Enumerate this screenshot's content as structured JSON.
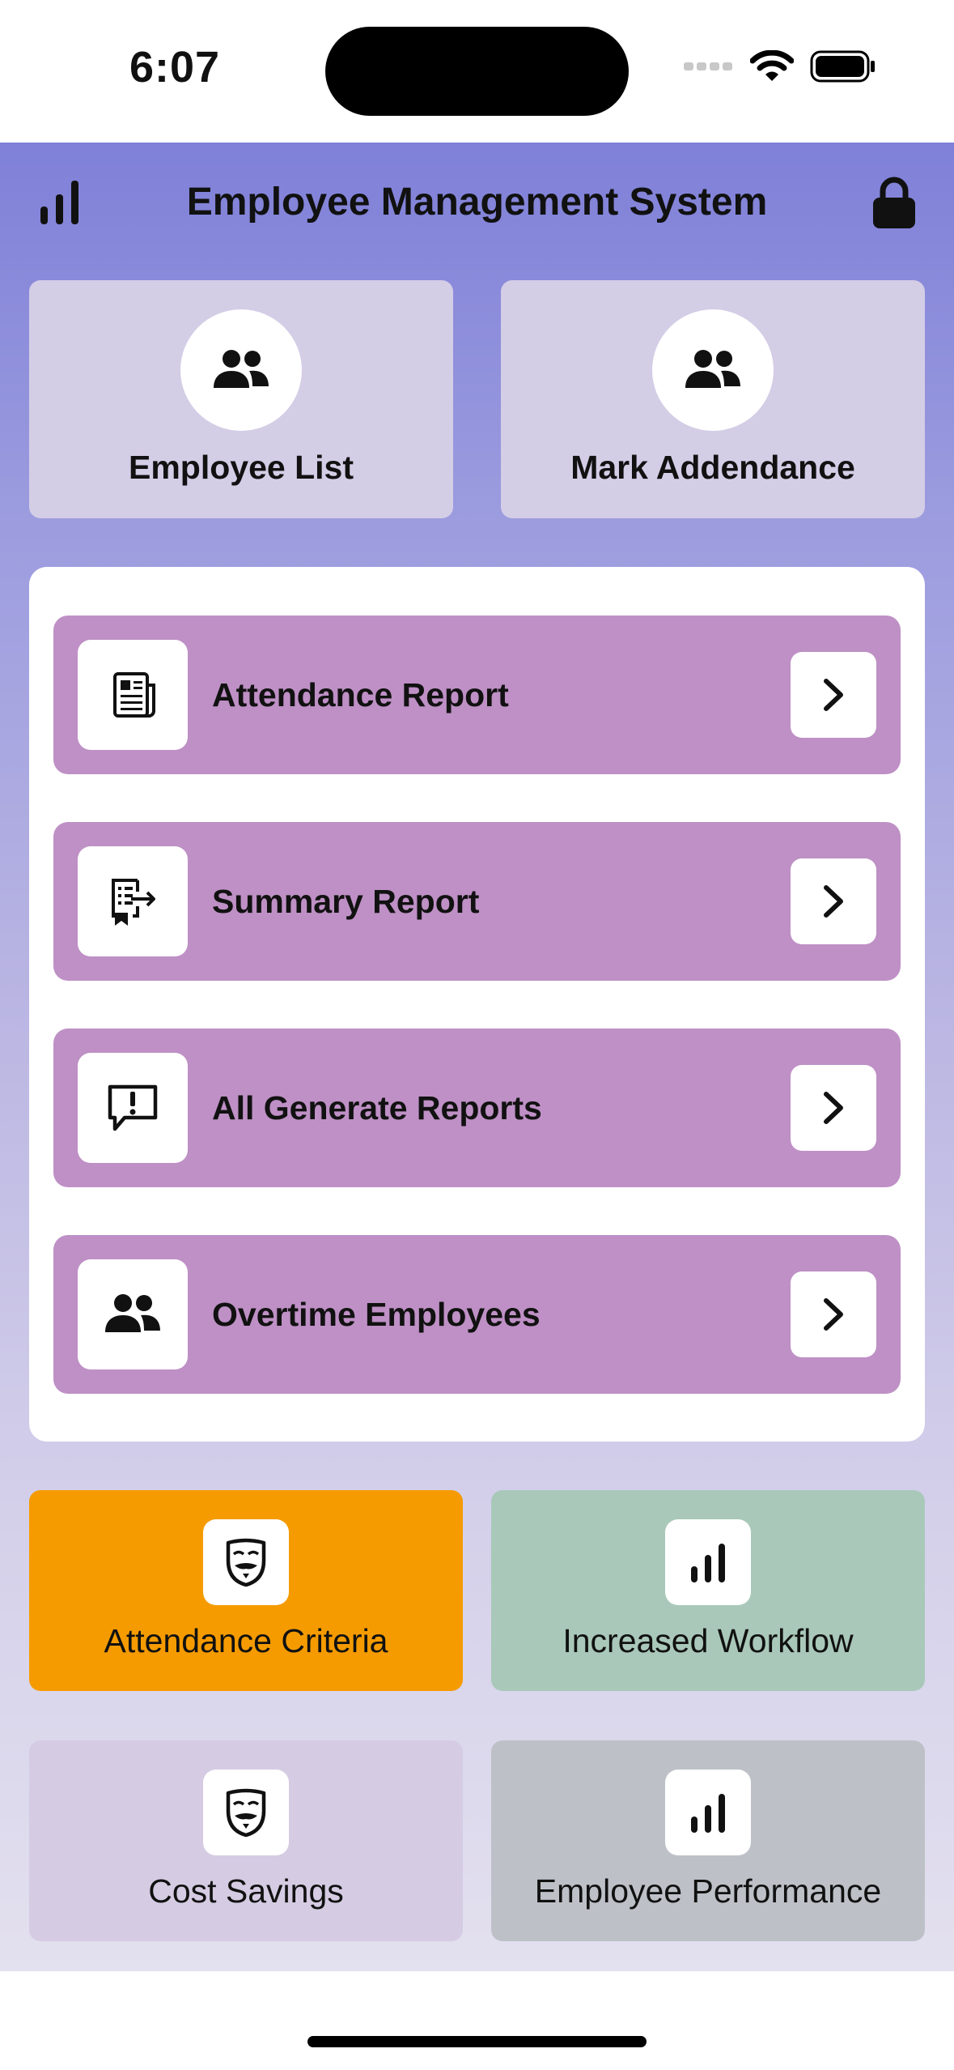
{
  "status": {
    "time": "6:07"
  },
  "header": {
    "title": "Employee Management System"
  },
  "top_cards": [
    {
      "label": "Employee List",
      "icon": "people-icon"
    },
    {
      "label": "Mark Addendance",
      "icon": "people-icon"
    }
  ],
  "menu": [
    {
      "label": "Attendance Report",
      "icon": "newspaper-icon"
    },
    {
      "label": "Summary Report",
      "icon": "export-report-icon"
    },
    {
      "label": "All Generate Reports",
      "icon": "alert-message-icon"
    },
    {
      "label": "Overtime Employees",
      "icon": "people-icon"
    }
  ],
  "tiles": [
    {
      "label": "Attendance Criteria",
      "icon": "mask-icon",
      "color": "#f59b00"
    },
    {
      "label": "Increased Workflow",
      "icon": "bar-chart-icon",
      "color": "#a9c8b9"
    },
    {
      "label": "Cost Savings",
      "icon": "mask-icon",
      "color": "#d5cce3"
    },
    {
      "label": "Employee Performance",
      "icon": "bar-chart-icon",
      "color": "#bdc1c7"
    }
  ],
  "colors": {
    "row": "#be90c5",
    "top_card": "#d4cde6",
    "header_top": "#7f80d8"
  }
}
